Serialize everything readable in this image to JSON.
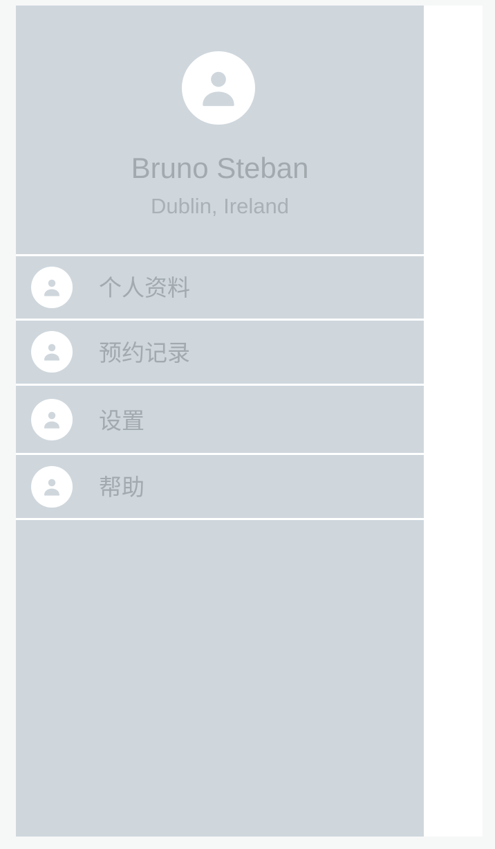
{
  "profile": {
    "name": "Bruno Steban",
    "location": "Dublin, Ireland",
    "avatar_icon": "person-icon"
  },
  "menu": {
    "items": [
      {
        "label": "个人资料",
        "icon": "person-icon"
      },
      {
        "label": "预约记录",
        "icon": "person-icon"
      },
      {
        "label": "设置",
        "icon": "person-icon"
      },
      {
        "label": "帮助",
        "icon": "person-icon"
      }
    ]
  },
  "colors": {
    "drawer_background": "#cfd7dd",
    "text": "#a2aaaf",
    "icon_circle": "#ffffff",
    "divider": "#ffffff",
    "page_background": "#ffffff"
  }
}
